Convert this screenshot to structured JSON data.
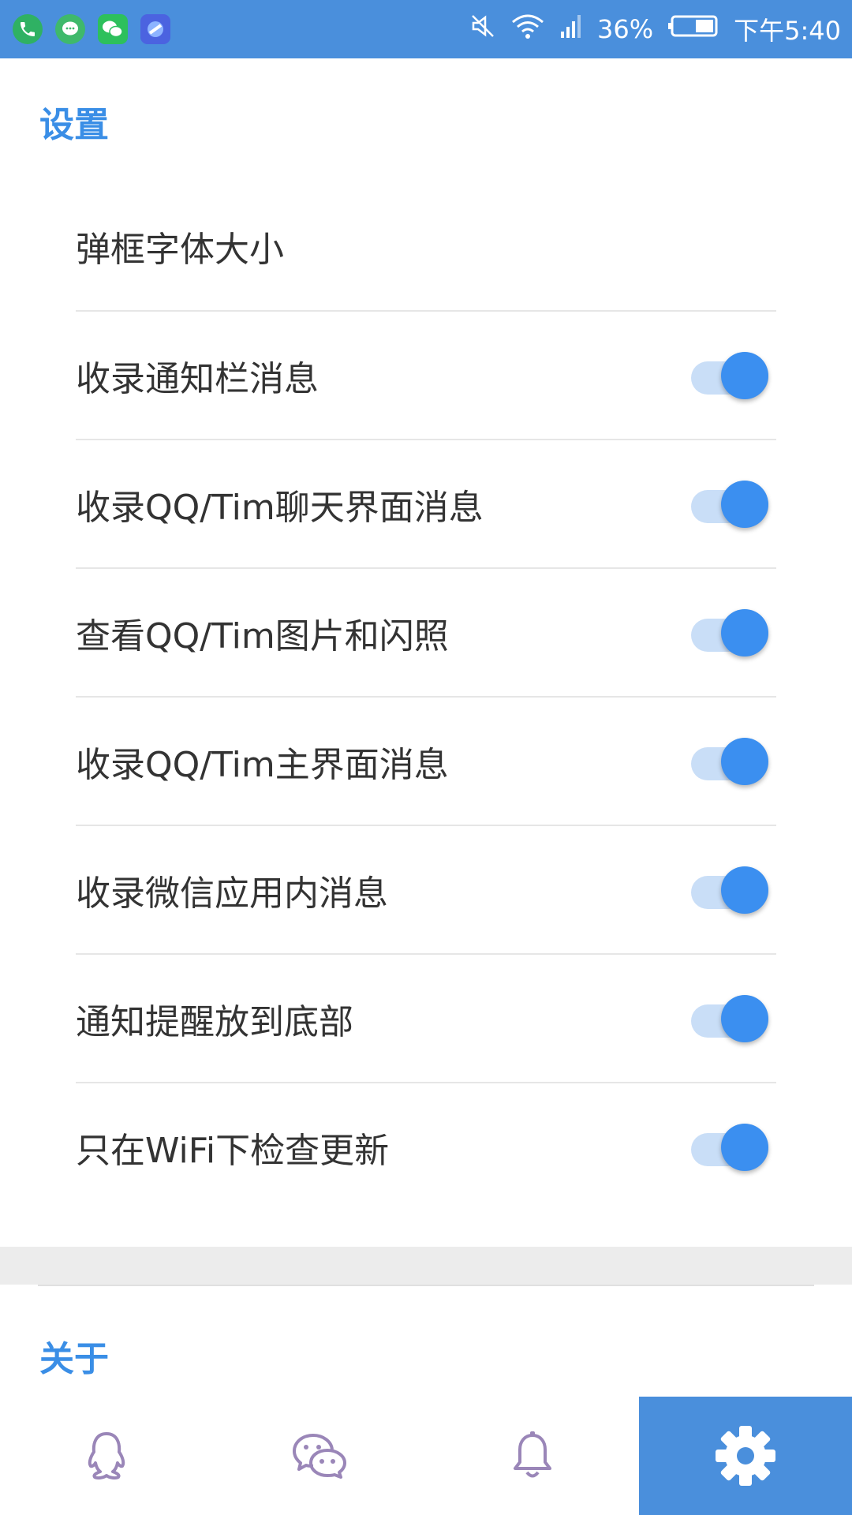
{
  "status_bar": {
    "battery": "36%",
    "time": "下午5:40",
    "apps": [
      "phone-icon",
      "messages-icon",
      "wechat-icon",
      "browser-icon"
    ]
  },
  "settings": {
    "title": "设置",
    "items": [
      {
        "label": "弹框字体大小",
        "has_toggle": false
      },
      {
        "label": "收录通知栏消息",
        "has_toggle": true,
        "on": true
      },
      {
        "label": "收录QQ/Tim聊天界面消息",
        "has_toggle": true,
        "on": true
      },
      {
        "label": "查看QQ/Tim图片和闪照",
        "has_toggle": true,
        "on": true
      },
      {
        "label": "收录QQ/Tim主界面消息",
        "has_toggle": true,
        "on": true
      },
      {
        "label": "收录微信应用内消息",
        "has_toggle": true,
        "on": true
      },
      {
        "label": "通知提醒放到底部",
        "has_toggle": true,
        "on": true
      },
      {
        "label": "只在WiFi下检查更新",
        "has_toggle": true,
        "on": true
      }
    ]
  },
  "about": {
    "title": "关于"
  },
  "bottom_nav": {
    "items": [
      {
        "name": "qq-icon",
        "active": false
      },
      {
        "name": "wechat-icon",
        "active": false
      },
      {
        "name": "bell-icon",
        "active": false
      },
      {
        "name": "settings-gear-icon",
        "active": true
      }
    ]
  },
  "colors": {
    "accent": "#3a8ee6",
    "status_bar": "#4a8fdc",
    "toggle_thumb": "#3b8ff0",
    "toggle_track": "#c9def7",
    "nav_icon": "#9a86b8"
  }
}
